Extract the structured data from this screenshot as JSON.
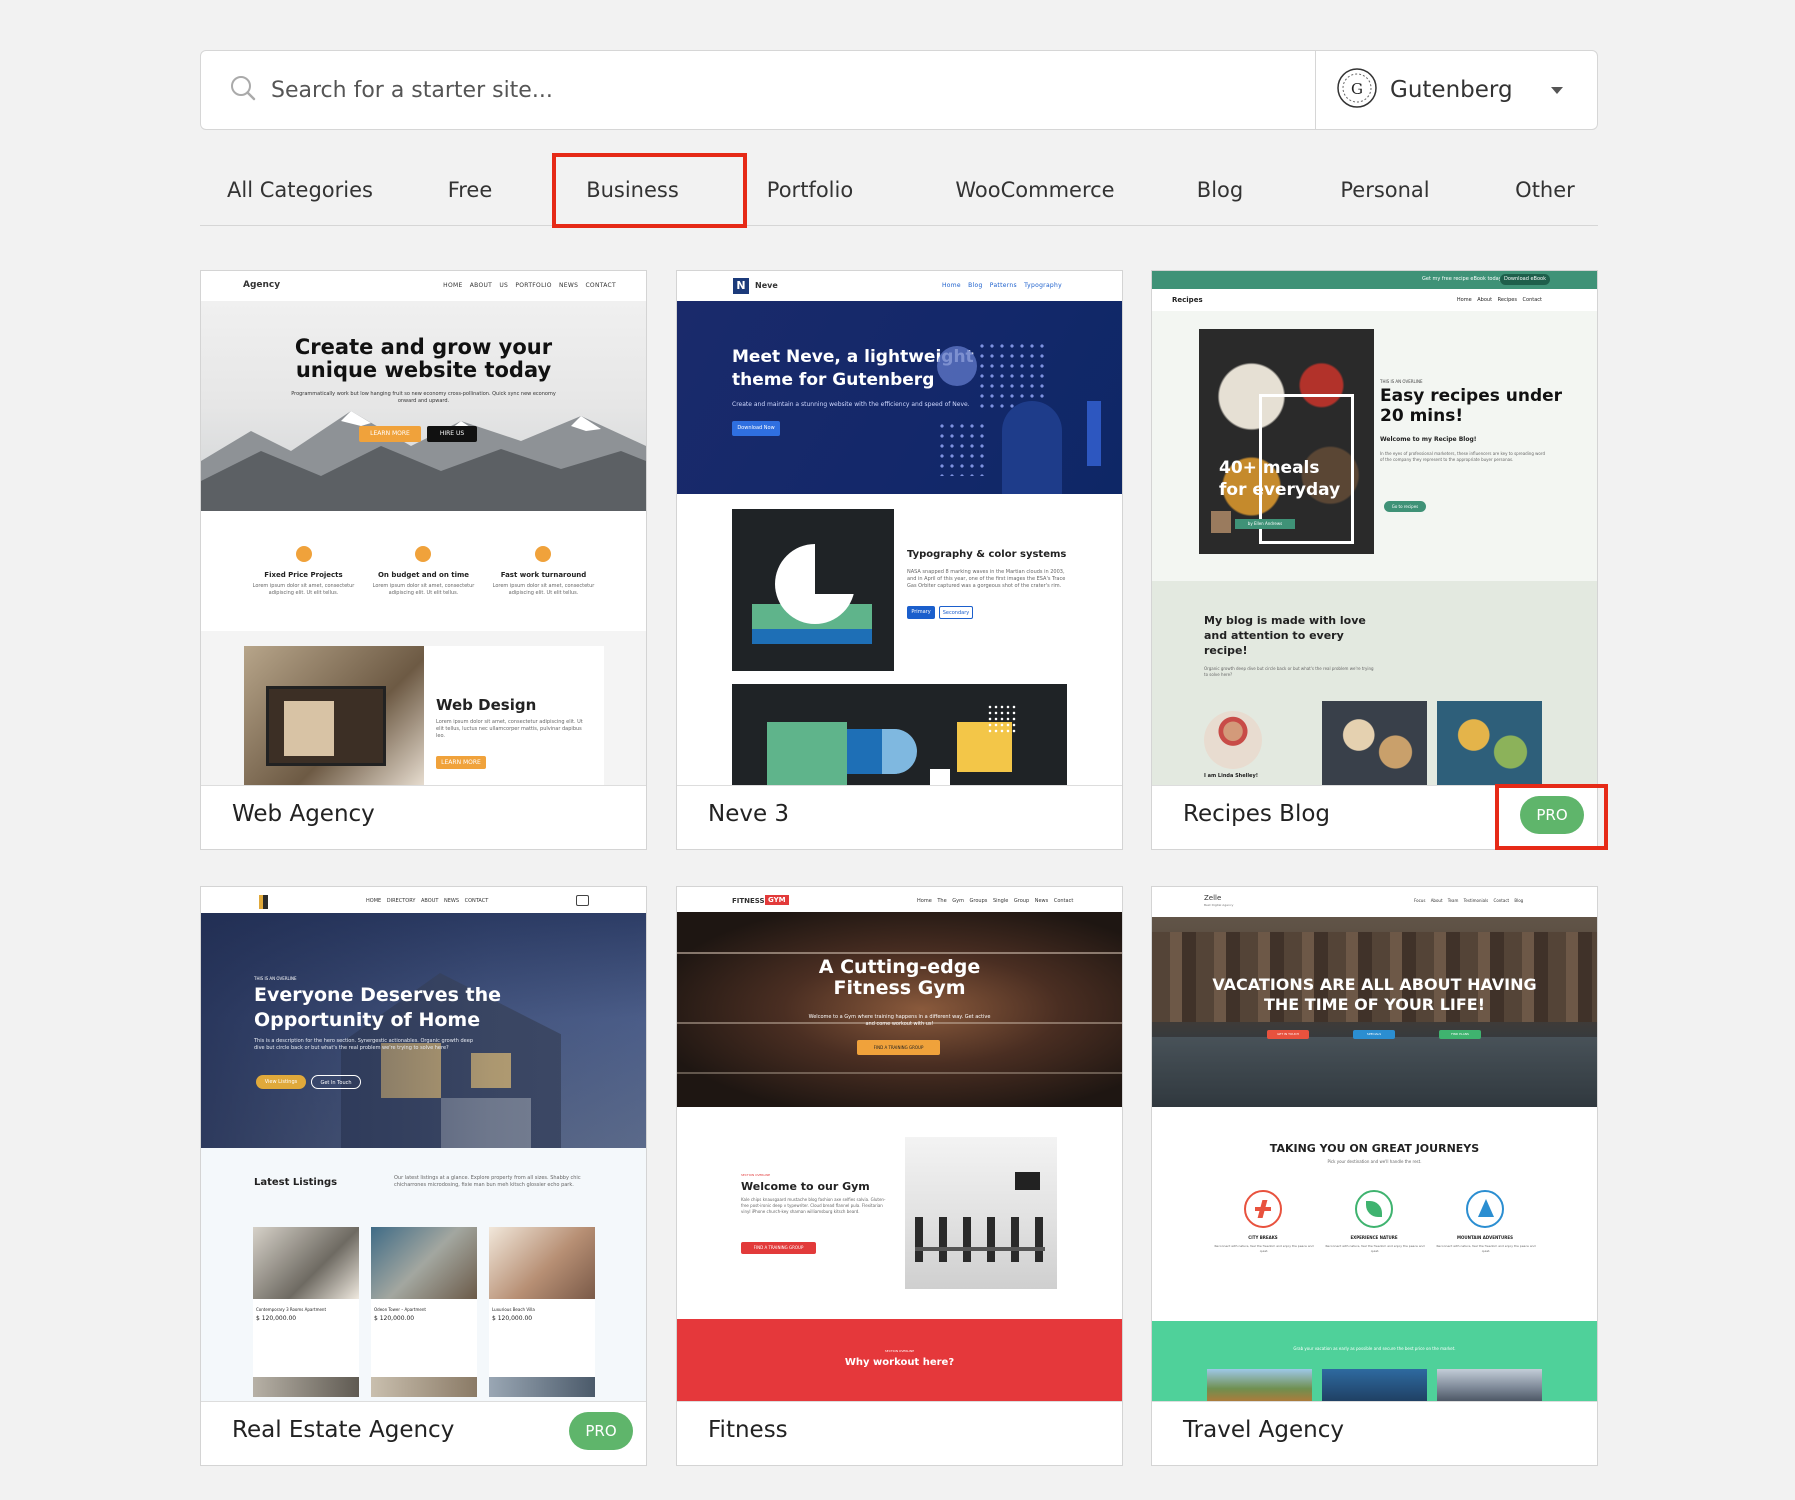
{
  "search": {
    "placeholder": "Search for a starter site..."
  },
  "builder": {
    "label": "Gutenberg",
    "logo_letter": "G"
  },
  "tabs": [
    "All Categories",
    "Free",
    "Business",
    "Portfolio",
    "WooCommerce",
    "Blog",
    "Personal",
    "Other"
  ],
  "active_tab": "Business",
  "highlight_color": "#e62a17",
  "pro_color": "#5fb56b",
  "cards": [
    {
      "title": "Web Agency",
      "pro": false,
      "preview": {
        "logo": "Agency",
        "nav": "HOME ABOUT US PORTFOLIO NEWS CONTACT",
        "hero_title_1": "Create and grow your",
        "hero_title_2": "unique website today",
        "hero_text": "Programmatically work but low hanging fruit so new economy cross-pollination. Quick sync new economy onward and upward.",
        "btn_1": "LEARN MORE",
        "btn_2": "HIRE US",
        "features": [
          "Fixed Price Projects",
          "On budget and on time",
          "Fast work turnaround"
        ],
        "feature_text": "Lorem ipsum dolor sit amet, consectetur adipiscing elit. Ut elit tellus.",
        "section_title": "Web Design",
        "section_text": "Lorem ipsum dolor sit amet, consectetur adipiscing elit. Ut elit tellus, luctus nec ullamcorper mattis, pulvinar dapibus leo.",
        "section_btn": "LEARN MORE"
      }
    },
    {
      "title": "Neve 3",
      "pro": false,
      "preview": {
        "logo": "Neve",
        "nav": "Home Blog Patterns Typography",
        "hero_title_1": "Meet Neve, a lightweight",
        "hero_title_2": "theme for Gutenberg",
        "hero_text": "Create and maintain a stunning website with the efficiency and speed of Neve.",
        "hero_btn": "Download Now",
        "section_title": "Typography & color systems",
        "section_text": "NASA snapped 8 marking waves in the Martian clouds in 2003, and in April of this year, one of the first images the ESA's Trace Gas Orbiter captured was a gorgeous shot of the crater's rim.",
        "btn_1": "Primary",
        "btn_2": "Secondary"
      }
    },
    {
      "title": "Recipes Blog",
      "pro": true,
      "preview": {
        "topbar": "Get my free recipe eBook today!",
        "topbar_btn": "Download eBook",
        "logo": "Recipes",
        "nav": "Home About Recipes Contact",
        "overline": "THIS IS AN OVERLINE",
        "hero_title_1": "Easy recipes under",
        "hero_title_2": "20 mins!",
        "welcome": "Welcome to my Recipe Blog!",
        "hero_text": "In the eyes of professional marketers, these influencers are key to spreading word of the company they represent to the appropriate buyer personas.",
        "hero_btn": "Go to recipes",
        "img_title_1": "40+ meals",
        "img_title_2": "for everyday",
        "byline": "by Ellen Andrews",
        "section_title": "My blog is made with love and attention to every recipe!",
        "section_text": "Organic growth deep dive but circle back or but what's the real problem we're trying to solve here?",
        "author": "I am Linda Shelley!"
      }
    },
    {
      "title": "Real Estate Agency",
      "pro": true,
      "preview": {
        "nav": "HOME DIRECTORY ABOUT NEWS CONTACT",
        "overline": "THIS IS AN OVERLINE",
        "hero_title_1": "Everyone Deserves the",
        "hero_title_2": "Opportunity of Home",
        "hero_text": "This is a description for the hero section. Synergestic actionables. Organic growth deep dive but circle back or but what's the real problem we're trying to solve here?",
        "btn_1": "View Listings",
        "btn_2": "Get In Touch",
        "section_title": "Latest Listings",
        "section_text": "Our latest listings at a glance. Explore property from all sizes. Shabby chic chicharrones microdosing, fixie man bun meh kitsch glossier echo park.",
        "listings": [
          {
            "name": "Contemporary 3 Rooms Apartment",
            "price": "$ 120,000.00"
          },
          {
            "name": "Odeon Tower – Apartment",
            "price": "$ 120,000.00"
          },
          {
            "name": "Luxurious Beach Villa",
            "price": "$ 120,000.00"
          }
        ]
      }
    },
    {
      "title": "Fitness",
      "pro": false,
      "preview": {
        "logo": "FITNESS",
        "logo_tag": "GYM",
        "nav": "Home The Gym Groups Single Group News Contact",
        "hero_title_1": "A Cutting-edge",
        "hero_title_2": "Fitness Gym",
        "hero_text": "Welcome to a Gym where training happens in a different way. Get active and come workout with us!",
        "hero_btn": "FIND A TRAINING GROUP",
        "overline": "SECTION OVERLINE",
        "section_title": "Welcome to our Gym",
        "section_text": "Kale chips knausgaard mustache blog fashion axe selfies salvia. Gluten-free post-ironic deep v typewriter. Cloud bread flannel pula. Flexitarian vinyl iPhone church-key shaman williamsburg kitsch beard.",
        "section_btn": "FIND A TRAINING GROUP",
        "band_overline": "SECTION OVERLINE",
        "band_title": "Why workout here?"
      }
    },
    {
      "title": "Travel Agency",
      "pro": false,
      "preview": {
        "logo": "Zelle",
        "logo_sub": "Best Digital Agency",
        "nav": "Focus About Team Testimonials Contact Blog",
        "hero_title_1": "VACATIONS ARE ALL ABOUT HAVING",
        "hero_title_2": "THE TIME OF YOUR LIFE!",
        "btn_1": "GET IN TOUCH",
        "btn_2": "SPECIALS",
        "btn_3": "FIND PLANS",
        "section_title": "TAKING YOU ON GREAT JOURNEYS",
        "section_sub": "Pick your destination and we'll handle the rest.",
        "features": [
          "CITY BREAKS",
          "EXPERIENCE NATURE",
          "MOUNTAIN ADVENTURES"
        ],
        "feature_text": "Reconnect with nature, feel the freedom and enjoy the peace and quiet.",
        "band_text": "Grab your vacation as early as possible and secure the best price on the market."
      }
    }
  ]
}
